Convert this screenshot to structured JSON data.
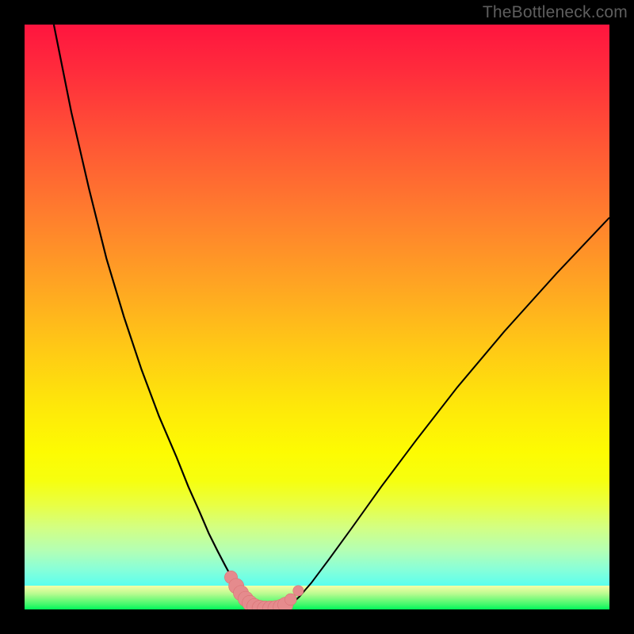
{
  "watermark": "TheBottleneck.com",
  "colors": {
    "frame": "#000000",
    "curve": "#000000",
    "marker_fill": "#e58b8d",
    "marker_stroke": "#d97274"
  },
  "chart_data": {
    "type": "line",
    "title": "",
    "xlabel": "",
    "ylabel": "",
    "xlim": [
      0,
      100
    ],
    "ylim": [
      0,
      100
    ],
    "series": [
      {
        "name": "left-curve",
        "x": [
          5,
          8,
          11,
          14,
          17,
          20,
          23,
          26,
          28,
          30,
          31.5,
          33,
          34.3,
          35.5,
          36.5,
          37.3,
          38,
          38.7,
          39.3
        ],
        "y": [
          100,
          85,
          72,
          60,
          50,
          41,
          33,
          26,
          21,
          16.5,
          13,
          10,
          7.5,
          5.3,
          3.7,
          2.5,
          1.6,
          0.8,
          0.1
        ]
      },
      {
        "name": "right-curve",
        "x": [
          44.5,
          45.5,
          47,
          49,
          52,
          56,
          61,
          67,
          74,
          82,
          91,
          100
        ],
        "y": [
          0.1,
          0.8,
          2.2,
          4.5,
          8.5,
          14,
          21,
          29,
          38,
          47.5,
          57.5,
          67
        ]
      },
      {
        "name": "valley-floor",
        "x": [
          39.3,
          40.5,
          42,
          43.3,
          44.5
        ],
        "y": [
          0.1,
          0,
          0,
          0,
          0.1
        ]
      }
    ],
    "markers": [
      {
        "x": 35.3,
        "y": 5.5,
        "r": 1.1
      },
      {
        "x": 36.2,
        "y": 4.0,
        "r": 1.3
      },
      {
        "x": 37.0,
        "y": 2.8,
        "r": 1.3
      },
      {
        "x": 37.8,
        "y": 1.8,
        "r": 1.3
      },
      {
        "x": 38.5,
        "y": 1.1,
        "r": 1.3
      },
      {
        "x": 39.3,
        "y": 0.55,
        "r": 1.3
      },
      {
        "x": 40.2,
        "y": 0.25,
        "r": 1.3
      },
      {
        "x": 41.1,
        "y": 0.15,
        "r": 1.3
      },
      {
        "x": 42.0,
        "y": 0.15,
        "r": 1.3
      },
      {
        "x": 42.9,
        "y": 0.2,
        "r": 1.3
      },
      {
        "x": 43.8,
        "y": 0.4,
        "r": 1.3
      },
      {
        "x": 44.6,
        "y": 0.8,
        "r": 1.3
      },
      {
        "x": 45.5,
        "y": 1.7,
        "r": 1.0
      },
      {
        "x": 46.8,
        "y": 3.2,
        "r": 0.9
      }
    ]
  }
}
